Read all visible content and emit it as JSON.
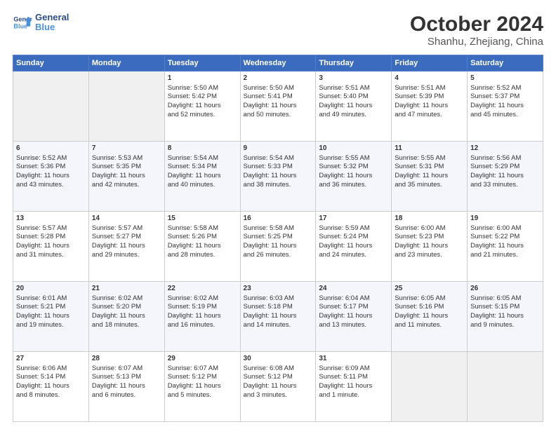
{
  "header": {
    "logo_line1": "General",
    "logo_line2": "Blue",
    "title": "October 2024",
    "subtitle": "Shanhu, Zhejiang, China"
  },
  "weekdays": [
    "Sunday",
    "Monday",
    "Tuesday",
    "Wednesday",
    "Thursday",
    "Friday",
    "Saturday"
  ],
  "weeks": [
    [
      {
        "day": "",
        "info": ""
      },
      {
        "day": "",
        "info": ""
      },
      {
        "day": "1",
        "info": "Sunrise: 5:50 AM\nSunset: 5:42 PM\nDaylight: 11 hours\nand 52 minutes."
      },
      {
        "day": "2",
        "info": "Sunrise: 5:50 AM\nSunset: 5:41 PM\nDaylight: 11 hours\nand 50 minutes."
      },
      {
        "day": "3",
        "info": "Sunrise: 5:51 AM\nSunset: 5:40 PM\nDaylight: 11 hours\nand 49 minutes."
      },
      {
        "day": "4",
        "info": "Sunrise: 5:51 AM\nSunset: 5:39 PM\nDaylight: 11 hours\nand 47 minutes."
      },
      {
        "day": "5",
        "info": "Sunrise: 5:52 AM\nSunset: 5:37 PM\nDaylight: 11 hours\nand 45 minutes."
      }
    ],
    [
      {
        "day": "6",
        "info": "Sunrise: 5:52 AM\nSunset: 5:36 PM\nDaylight: 11 hours\nand 43 minutes."
      },
      {
        "day": "7",
        "info": "Sunrise: 5:53 AM\nSunset: 5:35 PM\nDaylight: 11 hours\nand 42 minutes."
      },
      {
        "day": "8",
        "info": "Sunrise: 5:54 AM\nSunset: 5:34 PM\nDaylight: 11 hours\nand 40 minutes."
      },
      {
        "day": "9",
        "info": "Sunrise: 5:54 AM\nSunset: 5:33 PM\nDaylight: 11 hours\nand 38 minutes."
      },
      {
        "day": "10",
        "info": "Sunrise: 5:55 AM\nSunset: 5:32 PM\nDaylight: 11 hours\nand 36 minutes."
      },
      {
        "day": "11",
        "info": "Sunrise: 5:55 AM\nSunset: 5:31 PM\nDaylight: 11 hours\nand 35 minutes."
      },
      {
        "day": "12",
        "info": "Sunrise: 5:56 AM\nSunset: 5:29 PM\nDaylight: 11 hours\nand 33 minutes."
      }
    ],
    [
      {
        "day": "13",
        "info": "Sunrise: 5:57 AM\nSunset: 5:28 PM\nDaylight: 11 hours\nand 31 minutes."
      },
      {
        "day": "14",
        "info": "Sunrise: 5:57 AM\nSunset: 5:27 PM\nDaylight: 11 hours\nand 29 minutes."
      },
      {
        "day": "15",
        "info": "Sunrise: 5:58 AM\nSunset: 5:26 PM\nDaylight: 11 hours\nand 28 minutes."
      },
      {
        "day": "16",
        "info": "Sunrise: 5:58 AM\nSunset: 5:25 PM\nDaylight: 11 hours\nand 26 minutes."
      },
      {
        "day": "17",
        "info": "Sunrise: 5:59 AM\nSunset: 5:24 PM\nDaylight: 11 hours\nand 24 minutes."
      },
      {
        "day": "18",
        "info": "Sunrise: 6:00 AM\nSunset: 5:23 PM\nDaylight: 11 hours\nand 23 minutes."
      },
      {
        "day": "19",
        "info": "Sunrise: 6:00 AM\nSunset: 5:22 PM\nDaylight: 11 hours\nand 21 minutes."
      }
    ],
    [
      {
        "day": "20",
        "info": "Sunrise: 6:01 AM\nSunset: 5:21 PM\nDaylight: 11 hours\nand 19 minutes."
      },
      {
        "day": "21",
        "info": "Sunrise: 6:02 AM\nSunset: 5:20 PM\nDaylight: 11 hours\nand 18 minutes."
      },
      {
        "day": "22",
        "info": "Sunrise: 6:02 AM\nSunset: 5:19 PM\nDaylight: 11 hours\nand 16 minutes."
      },
      {
        "day": "23",
        "info": "Sunrise: 6:03 AM\nSunset: 5:18 PM\nDaylight: 11 hours\nand 14 minutes."
      },
      {
        "day": "24",
        "info": "Sunrise: 6:04 AM\nSunset: 5:17 PM\nDaylight: 11 hours\nand 13 minutes."
      },
      {
        "day": "25",
        "info": "Sunrise: 6:05 AM\nSunset: 5:16 PM\nDaylight: 11 hours\nand 11 minutes."
      },
      {
        "day": "26",
        "info": "Sunrise: 6:05 AM\nSunset: 5:15 PM\nDaylight: 11 hours\nand 9 minutes."
      }
    ],
    [
      {
        "day": "27",
        "info": "Sunrise: 6:06 AM\nSunset: 5:14 PM\nDaylight: 11 hours\nand 8 minutes."
      },
      {
        "day": "28",
        "info": "Sunrise: 6:07 AM\nSunset: 5:13 PM\nDaylight: 11 hours\nand 6 minutes."
      },
      {
        "day": "29",
        "info": "Sunrise: 6:07 AM\nSunset: 5:12 PM\nDaylight: 11 hours\nand 5 minutes."
      },
      {
        "day": "30",
        "info": "Sunrise: 6:08 AM\nSunset: 5:12 PM\nDaylight: 11 hours\nand 3 minutes."
      },
      {
        "day": "31",
        "info": "Sunrise: 6:09 AM\nSunset: 5:11 PM\nDaylight: 11 hours\nand 1 minute."
      },
      {
        "day": "",
        "info": ""
      },
      {
        "day": "",
        "info": ""
      }
    ]
  ]
}
